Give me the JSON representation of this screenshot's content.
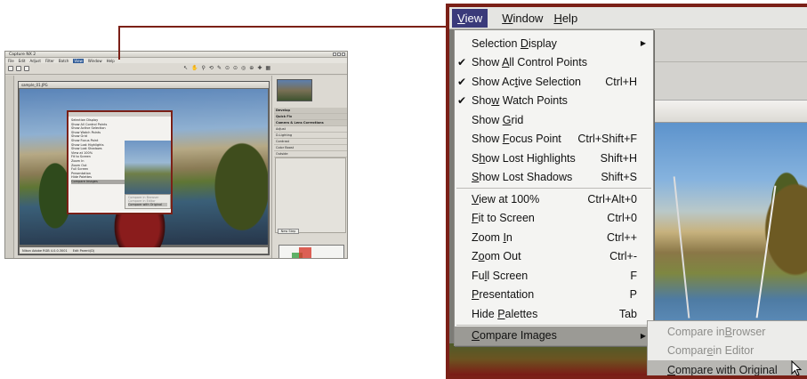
{
  "thumbnail": {
    "app_title": "Capture NX 2",
    "menus": [
      "File",
      "Edit",
      "Adjust",
      "Filter",
      "Batch",
      "View",
      "Window",
      "Help"
    ],
    "doc_title": "sample_01.JPG",
    "status_left": "Nikon Adobe RGB 4.0.0.3001",
    "status_right": "Edit Parent(D)",
    "panel_rows": [
      "Develop",
      "Quick Fix",
      "Camera & Lens Corrections",
      "Adjust",
      "D-Lighting",
      "Contrast",
      "Color Boost",
      "Outside"
    ],
    "new_step_label": "New Step",
    "histogram_label": "Histogram",
    "menu_items": [
      "Selection Display",
      "Show All Control Points",
      "Show Active Selection",
      "Show Watch Points",
      "Show Grid",
      "Show Focus Point",
      "Show Lost Highlights",
      "Show Lost Shadows",
      "View at 100%",
      "Fit to Screen",
      "Zoom In",
      "Zoom Out",
      "Full Screen",
      "Presentation",
      "Hide Palettes",
      "Compare Images"
    ],
    "submenu_items": [
      "Compare in Browser",
      "Compare in Editor",
      "Compare with Original"
    ]
  },
  "menubar": {
    "items": [
      {
        "label": "View",
        "mnemonic": "V",
        "rest": "iew",
        "active": true
      },
      {
        "label": "Window",
        "mnemonic": "W",
        "rest": "indow",
        "active": false
      },
      {
        "label": "Help",
        "mnemonic": "H",
        "rest": "elp",
        "active": false
      }
    ]
  },
  "view_menu": {
    "items": [
      {
        "pre": "Selection ",
        "u": "D",
        "post": "isplay",
        "shortcut": "",
        "checked": false,
        "submenu": true
      },
      {
        "pre": "Show ",
        "u": "A",
        "post": "ll Control Points",
        "shortcut": "",
        "checked": true,
        "submenu": false
      },
      {
        "pre": "Show Ac",
        "u": "t",
        "post": "ive Selection",
        "shortcut": "Ctrl+H",
        "checked": true,
        "submenu": false
      },
      {
        "pre": "Sho",
        "u": "w",
        "post": " Watch Points",
        "shortcut": "",
        "checked": true,
        "submenu": false
      },
      {
        "pre": "Show ",
        "u": "G",
        "post": "rid",
        "shortcut": "",
        "checked": false,
        "submenu": false
      },
      {
        "pre": "Show ",
        "u": "F",
        "post": "ocus Point",
        "shortcut": "Ctrl+Shift+F",
        "checked": false,
        "submenu": false
      },
      {
        "pre": "S",
        "u": "h",
        "post": "ow Lost Highlights",
        "shortcut": "Shift+H",
        "checked": false,
        "submenu": false
      },
      {
        "pre": "",
        "u": "S",
        "post": "how Lost Shadows",
        "shortcut": "Shift+S",
        "checked": false,
        "submenu": false
      },
      {
        "pre": "",
        "u": "V",
        "post": "iew at 100%",
        "shortcut": "Ctrl+Alt+0",
        "checked": false,
        "submenu": false
      },
      {
        "pre": "",
        "u": "F",
        "post": "it to Screen",
        "shortcut": "Ctrl+0",
        "checked": false,
        "submenu": false
      },
      {
        "pre": "Zoom ",
        "u": "I",
        "post": "n",
        "shortcut": "Ctrl++",
        "checked": false,
        "submenu": false
      },
      {
        "pre": "Z",
        "u": "o",
        "post": "om Out",
        "shortcut": "Ctrl+-",
        "checked": false,
        "submenu": false
      },
      {
        "pre": "Fu",
        "u": "l",
        "post": "l Screen",
        "shortcut": "F",
        "checked": false,
        "submenu": false
      },
      {
        "pre": "",
        "u": "P",
        "post": "resentation",
        "shortcut": "P",
        "checked": false,
        "submenu": false
      },
      {
        "pre": "Hide ",
        "u": "P",
        "post": "alettes",
        "shortcut": "Tab",
        "checked": false,
        "submenu": false
      },
      {
        "pre": "",
        "u": "C",
        "post": "ompare Images",
        "shortcut": "",
        "checked": false,
        "submenu": true,
        "highlighted": true
      }
    ]
  },
  "compare_submenu": {
    "items": [
      {
        "pre": "Compare in ",
        "u": "B",
        "post": "rowser",
        "highlighted": false
      },
      {
        "pre": "Compar",
        "u": "e",
        "post": " in Editor",
        "highlighted": false
      },
      {
        "pre": "",
        "u": "C",
        "post": "ompare with Original",
        "highlighted": true
      }
    ]
  },
  "colors": {
    "accent_frame": "#7b2017",
    "menu_highlight": "#9b9a95",
    "menubar_active": "#3a3a7a"
  },
  "icons": [
    "checkmark-icon",
    "submenu-arrow-icon",
    "mouse-pointer-icon"
  ]
}
